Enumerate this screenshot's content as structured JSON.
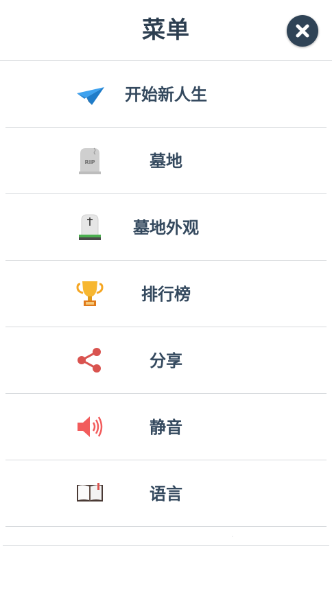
{
  "header": {
    "title": "菜单",
    "close_icon": "close-icon"
  },
  "menu": {
    "items": [
      {
        "label": "开始新人生",
        "icon": "paper-plane-icon",
        "color": "#2f8fdc"
      },
      {
        "label": "墓地",
        "icon": "tombstone-rip-icon",
        "color": "#c8c8c8"
      },
      {
        "label": "墓地外观",
        "icon": "tombstone-cross-icon",
        "color": "#4caf50"
      },
      {
        "label": "排行榜",
        "icon": "trophy-icon",
        "color": "#f5a623"
      },
      {
        "label": "分享",
        "icon": "share-icon",
        "color": "#d9534f"
      },
      {
        "label": "静音",
        "icon": "speaker-icon",
        "color": "#f25c5c"
      },
      {
        "label": "语言",
        "icon": "book-icon",
        "color": "#4a3a35"
      }
    ]
  },
  "tombstone_text": "RIP"
}
